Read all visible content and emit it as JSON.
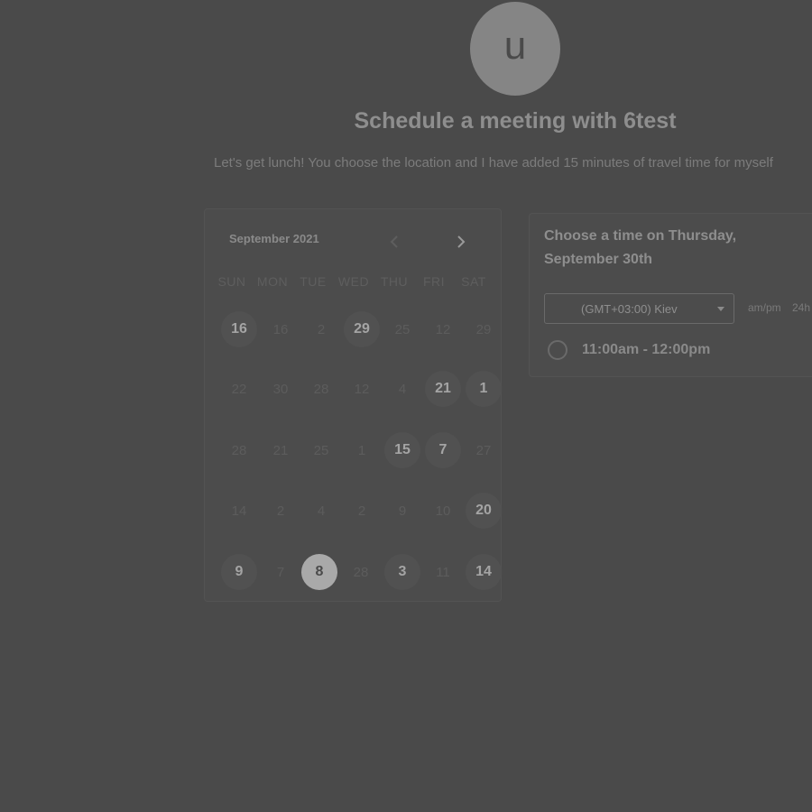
{
  "header": {
    "avatar_letter": "u",
    "title": "Schedule a meeting with 6test",
    "description": "Let's get lunch! You choose the location and I have added 15 minutes of travel time for myself"
  },
  "calendar": {
    "month_label": "September 2021",
    "prev_icon": "chevron-left-icon",
    "next_icon": "chevron-right-icon",
    "weekdays": [
      "SUN",
      "MON",
      "TUE",
      "WED",
      "THU",
      "FRI",
      "SAT"
    ],
    "weeks": [
      [
        {
          "label": "16",
          "state": "available"
        },
        {
          "label": "16",
          "state": "disabled"
        },
        {
          "label": "2",
          "state": "disabled"
        },
        {
          "label": "29",
          "state": "available"
        },
        {
          "label": "25",
          "state": "disabled"
        },
        {
          "label": "12",
          "state": "disabled"
        },
        {
          "label": "29",
          "state": "disabled"
        }
      ],
      [
        {
          "label": "22",
          "state": "disabled"
        },
        {
          "label": "30",
          "state": "disabled"
        },
        {
          "label": "28",
          "state": "disabled"
        },
        {
          "label": "12",
          "state": "disabled"
        },
        {
          "label": "4",
          "state": "disabled"
        },
        {
          "label": "21",
          "state": "available"
        },
        {
          "label": "1",
          "state": "available"
        }
      ],
      [
        {
          "label": "28",
          "state": "disabled"
        },
        {
          "label": "21",
          "state": "disabled"
        },
        {
          "label": "25",
          "state": "disabled"
        },
        {
          "label": "1",
          "state": "disabled"
        },
        {
          "label": "15",
          "state": "available"
        },
        {
          "label": "7",
          "state": "available"
        },
        {
          "label": "27",
          "state": "disabled"
        }
      ],
      [
        {
          "label": "14",
          "state": "disabled"
        },
        {
          "label": "2",
          "state": "disabled"
        },
        {
          "label": "4",
          "state": "disabled"
        },
        {
          "label": "2",
          "state": "disabled"
        },
        {
          "label": "9",
          "state": "disabled"
        },
        {
          "label": "10",
          "state": "disabled"
        },
        {
          "label": "20",
          "state": "available"
        }
      ],
      [
        {
          "label": "9",
          "state": "available"
        },
        {
          "label": "7",
          "state": "disabled"
        },
        {
          "label": "8",
          "state": "selected"
        },
        {
          "label": "28",
          "state": "disabled"
        },
        {
          "label": "3",
          "state": "available"
        },
        {
          "label": "11",
          "state": "disabled"
        },
        {
          "label": "14",
          "state": "available"
        }
      ]
    ]
  },
  "time_panel": {
    "heading": "Choose a time on Thursday, September 30th",
    "timezone": "(GMT+03:00) Kiev",
    "format_ampm": "am/pm",
    "format_24h": "24h",
    "slots": [
      {
        "label": "11:00am - 12:00pm",
        "selected": false
      }
    ]
  }
}
